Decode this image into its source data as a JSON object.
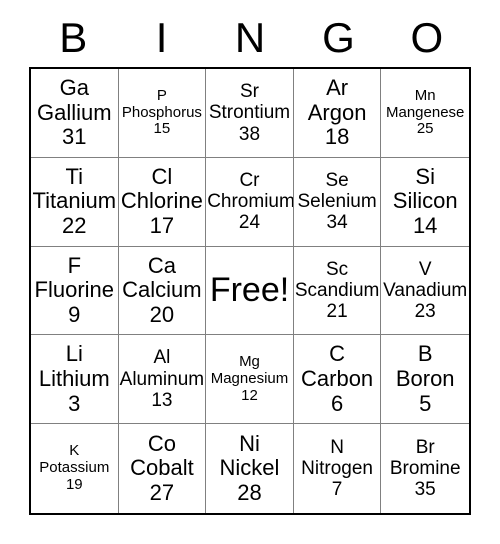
{
  "card": {
    "type": "bingo-card",
    "header_letters": [
      "B",
      "I",
      "N",
      "G",
      "O"
    ],
    "free_space_label": "Free!",
    "colors": {
      "background": "#ffffff",
      "text": "#000000",
      "outer_border": "#000000",
      "inner_border": "#808080"
    },
    "rows": [
      [
        {
          "symbol": "Ga",
          "name": "Gallium",
          "number": "31",
          "size": "lg"
        },
        {
          "symbol": "P",
          "name": "Phosphorus",
          "number": "15",
          "size": "sm"
        },
        {
          "symbol": "Sr",
          "name": "Strontium",
          "number": "38",
          "size": "md"
        },
        {
          "symbol": "Ar",
          "name": "Argon",
          "number": "18",
          "size": "lg"
        },
        {
          "symbol": "Mn",
          "name": "Mangenese",
          "number": "25",
          "size": "sm"
        }
      ],
      [
        {
          "symbol": "Ti",
          "name": "Titanium",
          "number": "22",
          "size": "lg"
        },
        {
          "symbol": "Cl",
          "name": "Chlorine",
          "number": "17",
          "size": "lg"
        },
        {
          "symbol": "Cr",
          "name": "Chromium",
          "number": "24",
          "size": "md"
        },
        {
          "symbol": "Se",
          "name": "Selenium",
          "number": "34",
          "size": "md"
        },
        {
          "symbol": "Si",
          "name": "Silicon",
          "number": "14",
          "size": "lg"
        }
      ],
      [
        {
          "symbol": "F",
          "name": "Fluorine",
          "number": "9",
          "size": "lg"
        },
        {
          "symbol": "Ca",
          "name": "Calcium",
          "number": "20",
          "size": "lg"
        },
        {
          "free": true,
          "label": "Free!"
        },
        {
          "symbol": "Sc",
          "name": "Scandium",
          "number": "21",
          "size": "md"
        },
        {
          "symbol": "V",
          "name": "Vanadium",
          "number": "23",
          "size": "md"
        }
      ],
      [
        {
          "symbol": "Li",
          "name": "Lithium",
          "number": "3",
          "size": "lg"
        },
        {
          "symbol": "Al",
          "name": "Aluminum",
          "number": "13",
          "size": "md"
        },
        {
          "symbol": "Mg",
          "name": "Magnesium",
          "number": "12",
          "size": "sm"
        },
        {
          "symbol": "C",
          "name": "Carbon",
          "number": "6",
          "size": "lg"
        },
        {
          "symbol": "B",
          "name": "Boron",
          "number": "5",
          "size": "lg"
        }
      ],
      [
        {
          "symbol": "K",
          "name": "Potassium",
          "number": "19",
          "size": "sm"
        },
        {
          "symbol": "Co",
          "name": "Cobalt",
          "number": "27",
          "size": "lg"
        },
        {
          "symbol": "Ni",
          "name": "Nickel",
          "number": "28",
          "size": "lg"
        },
        {
          "symbol": "N",
          "name": "Nitrogen",
          "number": "7",
          "size": "md"
        },
        {
          "symbol": "Br",
          "name": "Bromine",
          "number": "35",
          "size": "md"
        }
      ]
    ]
  }
}
